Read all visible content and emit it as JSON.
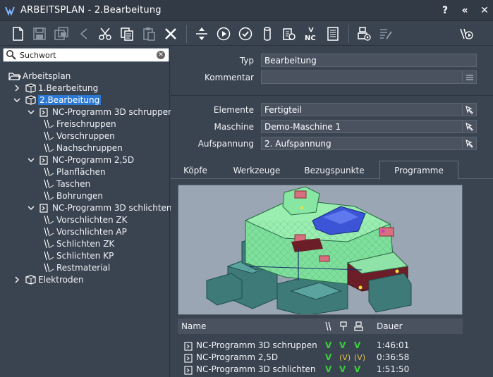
{
  "window": {
    "title": "ARBEITSPLAN - 2.Bearbeitung",
    "controls": [
      "?",
      "«",
      "✕"
    ]
  },
  "toolbar": {
    "buttons": [
      "new-file",
      "save",
      "save-all",
      "undo",
      "cut",
      "copy",
      "paste",
      "delete",
      "move",
      "play",
      "check",
      "cylinder",
      "clipboard-check",
      "nc",
      "list",
      "machine-play",
      "edit-list",
      "tool-play"
    ]
  },
  "search": {
    "value": "Suchwort",
    "placeholder": "Suchwort"
  },
  "tree": {
    "root": "Arbeitsplan",
    "nodes": [
      {
        "label": "1.Bearbeitung",
        "depth": 1,
        "expanded": false
      },
      {
        "label": "2.Bearbeitung",
        "depth": 1,
        "expanded": true,
        "selected": true
      },
      {
        "label": "NC-Programm 3D schruppen",
        "depth": 2,
        "expanded": true
      },
      {
        "label": "Freischruppen",
        "depth": 3
      },
      {
        "label": "Vorschruppen",
        "depth": 3
      },
      {
        "label": "Nachschruppen",
        "depth": 3
      },
      {
        "label": "NC-Programm 2,5D",
        "depth": 2,
        "expanded": true
      },
      {
        "label": "Planflächen",
        "depth": 3
      },
      {
        "label": "Taschen",
        "depth": 3
      },
      {
        "label": "Bohrungen",
        "depth": 3
      },
      {
        "label": "NC-Programm 3D schlichten",
        "depth": 2,
        "expanded": true
      },
      {
        "label": "Vorschlichten ZK",
        "depth": 3
      },
      {
        "label": "Vorschlichten AP",
        "depth": 3
      },
      {
        "label": "Schlichten ZK",
        "depth": 3
      },
      {
        "label": "Schlichten KP",
        "depth": 3
      },
      {
        "label": "Restmaterial",
        "depth": 3
      },
      {
        "label": "Elektroden",
        "depth": 1,
        "expanded": false
      }
    ]
  },
  "form": {
    "typ_label": "Typ",
    "typ_value": "Bearbeitung",
    "kommentar_label": "Kommentar",
    "kommentar_value": "",
    "elemente_label": "Elemente",
    "elemente_value": "Fertigteil",
    "maschine_label": "Maschine",
    "maschine_value": "Demo-Maschine 1",
    "aufspannung_label": "Aufspannung",
    "aufspannung_value": "2. Aufspannung"
  },
  "tabs": [
    {
      "label": "Köpfe"
    },
    {
      "label": "Werkzeuge"
    },
    {
      "label": "Bezugspunkte"
    },
    {
      "label": "Programme",
      "active": true
    }
  ],
  "grid": {
    "col_name": "Name",
    "col_dauer": "Dauer",
    "rows": [
      {
        "name": "NC-Programm 3D schruppen",
        "checks": [
          "V",
          "V",
          "V"
        ],
        "dauer": "1:46:01"
      },
      {
        "name": "NC-Programm 2,5D",
        "checks": [
          "V",
          "(V)",
          "(V)"
        ],
        "dauer": "0:36:58"
      },
      {
        "name": "NC-Programm 3D schlichten",
        "checks": [
          "V",
          "V",
          "V"
        ],
        "dauer": "1:51:50"
      }
    ]
  },
  "colors": {
    "accent": "#2b78d4",
    "background": "#3a4350",
    "check_green": "#3ad13a",
    "check_yellow": "#e8c14a"
  }
}
